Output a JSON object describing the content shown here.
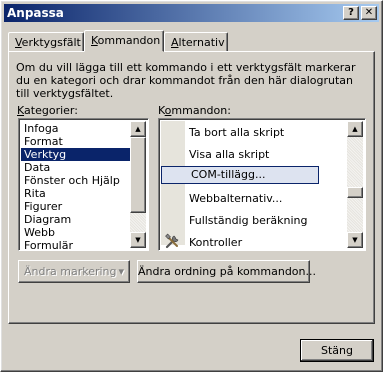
{
  "window": {
    "title": "Anpassa",
    "help_button": "?",
    "close_button": "✕"
  },
  "tabs": [
    {
      "label": "Verktygsfält",
      "accel": "V",
      "rest": "erktygsfält",
      "active": false
    },
    {
      "label": "Kommandon",
      "accel": "K",
      "rest": "ommandon",
      "active": true
    },
    {
      "label": "Alternativ",
      "accel": "A",
      "rest": "lternativ",
      "active": false
    }
  ],
  "intro_text": "Om du vill lägga till ett kommando i ett verktygsfält markerar du en kategori och drar kommandot från den här dialogrutan till verktygsfältet.",
  "categories": {
    "label_accel": "K",
    "label_rest": "ategorier:",
    "items": [
      "Infoga",
      "Format",
      "Verktyg",
      "Data",
      "Fönster och Hjälp",
      "Rita",
      "Figurer",
      "Diagram",
      "Webb",
      "Formulär"
    ],
    "selected": "Verktyg"
  },
  "commands": {
    "label_accel": "o",
    "label_pre": "K",
    "label_rest": "mmandon:",
    "items": [
      {
        "label": "Ta bort alla skript",
        "icon": ""
      },
      {
        "label": "Visa alla skript",
        "icon": ""
      },
      {
        "label": "COM-tillägg...",
        "icon": "",
        "selected": true
      },
      {
        "label": "Webbalternativ...",
        "icon": ""
      },
      {
        "label": "Fullständig beräkning",
        "icon": ""
      },
      {
        "label": "Kontroller",
        "icon": "tools-icon"
      }
    ]
  },
  "buttons": {
    "modify_selection": "Ändra markering",
    "modify_selection_arrow": "▾",
    "rearrange": "Ändra ordning på kommandon...",
    "close": "Stäng"
  }
}
